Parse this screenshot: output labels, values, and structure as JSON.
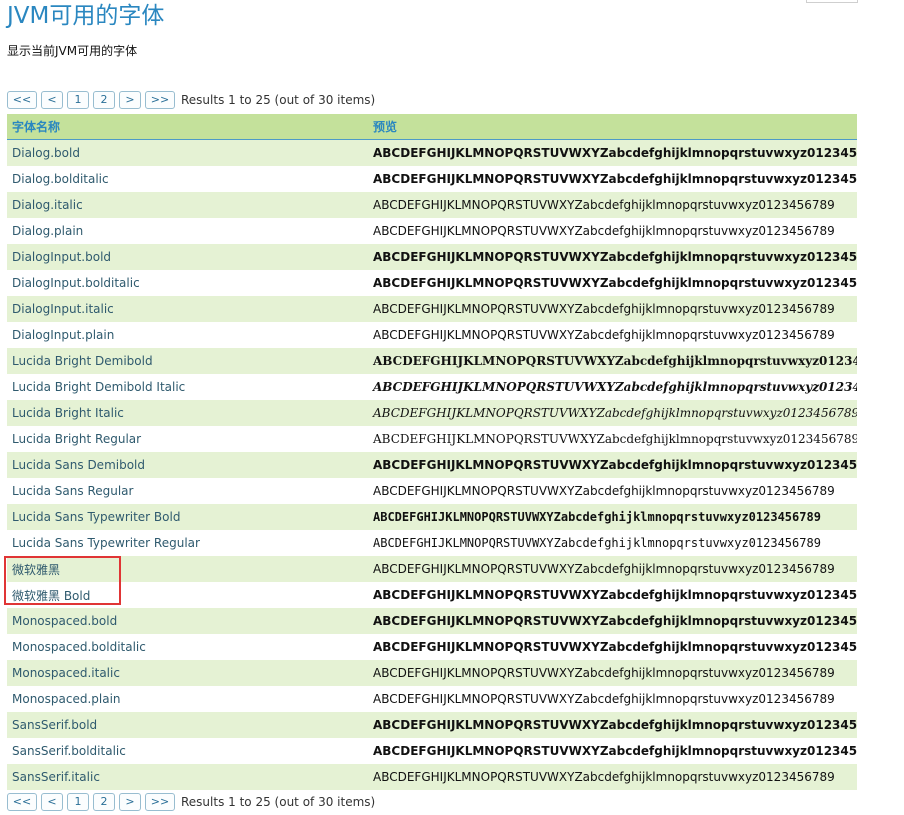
{
  "page": {
    "title": "JVM可用的字体",
    "subtitle": "显示当前JVM可用的字体"
  },
  "pager": {
    "first": "<<",
    "prev": "<",
    "page1": "1",
    "page2": "2",
    "next": ">",
    "last": ">>",
    "results": "Results 1 to 25 (out of 30 items)"
  },
  "table": {
    "headers": {
      "name": "字体名称",
      "preview": "预览"
    },
    "preview_text": "ABCDEFGHIJKLMNOPQRSTUVWXYZabcdefghijklmnopqrstuvwxyz0123456789",
    "rows": [
      {
        "name": "Dialog.bold",
        "style": "b"
      },
      {
        "name": "Dialog.bolditalic",
        "style": "b"
      },
      {
        "name": "Dialog.italic",
        "style": ""
      },
      {
        "name": "Dialog.plain",
        "style": ""
      },
      {
        "name": "DialogInput.bold",
        "style": "b"
      },
      {
        "name": "DialogInput.bolditalic",
        "style": "b"
      },
      {
        "name": "DialogInput.italic",
        "style": ""
      },
      {
        "name": "DialogInput.plain",
        "style": ""
      },
      {
        "name": "Lucida Bright Demibold",
        "style": "serif b"
      },
      {
        "name": "Lucida Bright Demibold Italic",
        "style": "serif bi"
      },
      {
        "name": "Lucida Bright Italic",
        "style": "serif i"
      },
      {
        "name": "Lucida Bright Regular",
        "style": "serif"
      },
      {
        "name": "Lucida Sans Demibold",
        "style": "b"
      },
      {
        "name": "Lucida Sans Regular",
        "style": ""
      },
      {
        "name": "Lucida Sans Typewriter Bold",
        "style": "mono b"
      },
      {
        "name": "Lucida Sans Typewriter Regular",
        "style": "mono"
      },
      {
        "name": "微软雅黑",
        "style": ""
      },
      {
        "name": "微软雅黑 Bold",
        "style": "b"
      },
      {
        "name": "Monospaced.bold",
        "style": "b"
      },
      {
        "name": "Monospaced.bolditalic",
        "style": "b"
      },
      {
        "name": "Monospaced.italic",
        "style": ""
      },
      {
        "name": "Monospaced.plain",
        "style": ""
      },
      {
        "name": "SansSerif.bold",
        "style": "b"
      },
      {
        "name": "SansSerif.bolditalic",
        "style": "b"
      },
      {
        "name": "SansSerif.italic",
        "style": ""
      }
    ]
  },
  "colors": {
    "title": "#2a87c0",
    "header_bg": "#c4e19b",
    "row_alt_bg": "#e5f2d4",
    "highlight_border": "#e03535"
  }
}
